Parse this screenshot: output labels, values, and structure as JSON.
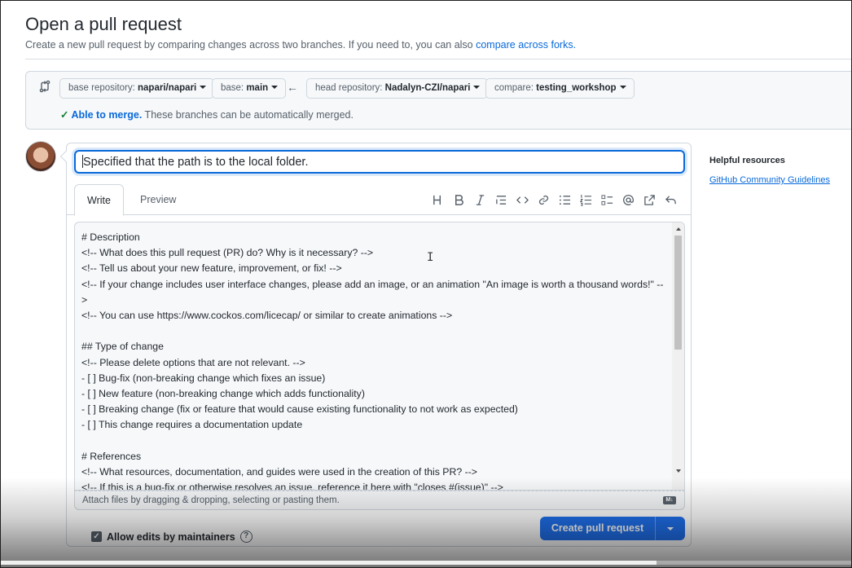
{
  "page": {
    "title": "Open a pull request",
    "subtitle_prefix": "Create a new pull request by comparing changes across two branches. If you need to, you can also ",
    "subtitle_link": "compare across forks."
  },
  "range": {
    "base_repo_label": "base repository: ",
    "base_repo_value": "napari/napari",
    "base_label": "base: ",
    "base_value": "main",
    "head_repo_label": "head repository: ",
    "head_repo_value": "Nadalyn-CZI/napari",
    "compare_label": "compare: ",
    "compare_value": "testing_workshop",
    "merge_ok": "Able to merge.",
    "merge_text": " These branches can be automatically merged."
  },
  "composer": {
    "title_value": "Specified that the path is to the local folder.",
    "tab_write": "Write",
    "tab_preview": "Preview",
    "toolbar": [
      "heading-icon",
      "bold-icon",
      "italic-icon",
      "quote-icon",
      "code-icon",
      "link-icon",
      "unordered-list-icon",
      "ordered-list-icon",
      "task-list-icon",
      "mention-icon",
      "reference-icon",
      "undo-icon"
    ],
    "body": "# Description\n<!-- What does this pull request (PR) do? Why is it necessary? -->\n<!-- Tell us about your new feature, improvement, or fix! -->\n<!-- If your change includes user interface changes, please add an image, or an animation \"An image is worth a thousand words!\" -->\n<!-- You can use https://www.cockos.com/licecap/ or similar to create animations -->\n\n## Type of change\n<!-- Please delete options that are not relevant. -->\n- [ ] Bug-fix (non-breaking change which fixes an issue)\n- [ ] New feature (non-breaking change which adds functionality)\n- [ ] Breaking change (fix or feature that would cause existing functionality to not work as expected)\n- [ ] This change requires a documentation update\n\n# References\n<!-- What resources, documentation, and guides were used in the creation of this PR? -->\n<!-- If this is a bug-fix or otherwise resolves an issue, reference it here with \"closes #(issue)\" -->",
    "attach_text": "Attach files by dragging & dropping, selecting or pasting them.",
    "allow_edits": "Allow edits by maintainers",
    "create_button": "Create pull request"
  },
  "sidebar": {
    "heading": "Helpful resources",
    "link": "GitHub Community Guidelines"
  },
  "video": {
    "progress": 0.77
  },
  "colors": {
    "accent": "#0969da",
    "primary_button": "#1f6feb"
  }
}
